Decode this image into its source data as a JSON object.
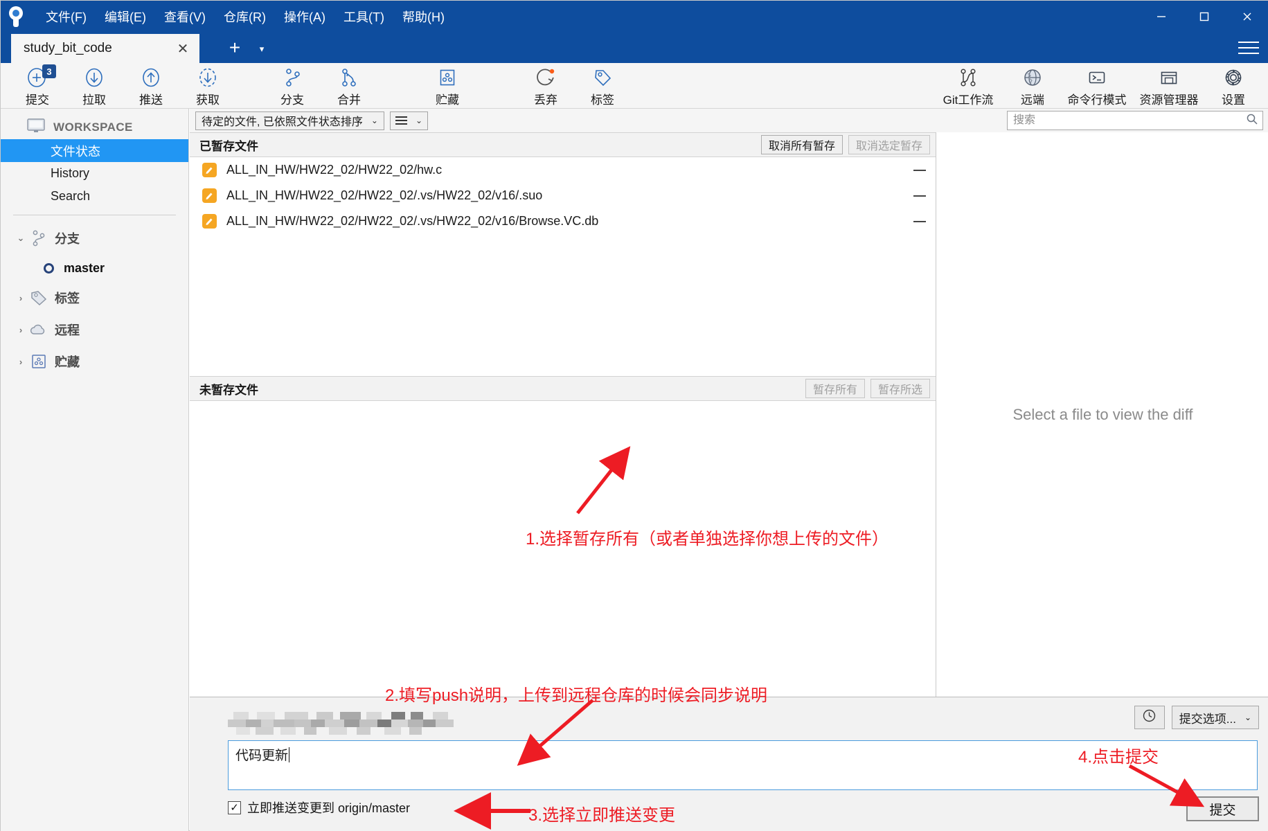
{
  "window": {
    "menu": [
      "文件(F)",
      "编辑(E)",
      "查看(V)",
      "仓库(R)",
      "操作(A)",
      "工具(T)",
      "帮助(H)"
    ],
    "minimize_label": "最小化",
    "maximize_label": "最大化",
    "close_label": "关闭"
  },
  "tabs": {
    "active_title": "study_bit_code",
    "close_label": "✕",
    "add_label": "+",
    "dropdown_label": "▾"
  },
  "toolbar": {
    "left": [
      {
        "label": "提交",
        "icon": "commit-plus-icon",
        "badge": "3"
      },
      {
        "label": "拉取",
        "icon": "pull-down-arrow-icon",
        "badge": ""
      },
      {
        "label": "推送",
        "icon": "push-up-arrow-icon",
        "badge": ""
      },
      {
        "label": "获取",
        "icon": "fetch-dashed-arrow-icon",
        "badge": ""
      },
      {
        "label": "分支",
        "icon": "branch-icon",
        "badge": ""
      },
      {
        "label": "合并",
        "icon": "merge-icon",
        "badge": ""
      },
      {
        "label": "贮藏",
        "icon": "stash-icon",
        "badge": ""
      },
      {
        "label": "丢弃",
        "icon": "discard-revert-icon",
        "badge": ""
      },
      {
        "label": "标签",
        "icon": "tag-icon",
        "badge": ""
      }
    ],
    "right": [
      {
        "label": "Git工作流",
        "icon": "git-flow-icon"
      },
      {
        "label": "远端",
        "icon": "globe-remote-icon"
      },
      {
        "label": "命令行模式",
        "icon": "terminal-icon"
      },
      {
        "label": "资源管理器",
        "icon": "explorer-folder-icon"
      },
      {
        "label": "设置",
        "icon": "gear-icon"
      }
    ]
  },
  "sidebar": {
    "workspace_label": "WORKSPACE",
    "nav": [
      {
        "label": "文件状态",
        "active": true
      },
      {
        "label": "History",
        "active": false
      },
      {
        "label": "Search",
        "active": false
      }
    ],
    "sections": [
      {
        "label": "分支",
        "icon": "branch-icon",
        "expanded": true,
        "chevron": "⌄"
      },
      {
        "label": "标签",
        "icon": "tag-icon",
        "expanded": false,
        "chevron": "›"
      },
      {
        "label": "远程",
        "icon": "cloud-icon",
        "expanded": false,
        "chevron": "›"
      },
      {
        "label": "贮藏",
        "icon": "stash-icon",
        "expanded": false,
        "chevron": "›"
      }
    ],
    "branches": [
      "master"
    ]
  },
  "filter_bar": {
    "sort_value": "待定的文件, 已依照文件状态排序",
    "sort_caret": "⌄",
    "view_caret": "⌄",
    "search_placeholder": "搜索",
    "search_value": ""
  },
  "staged": {
    "title": "已暂存文件",
    "unstage_all_label": "取消所有暂存",
    "unstage_selected_label": "取消选定暂存",
    "files": [
      "ALL_IN_HW/HW22_02/HW22_02/hw.c",
      "ALL_IN_HW/HW22_02/HW22_02/.vs/HW22_02/v16/.suo",
      "ALL_IN_HW/HW22_02/HW22_02/.vs/HW22_02/v16/Browse.VC.db"
    ]
  },
  "unstaged": {
    "title": "未暂存文件",
    "stage_all_label": "暂存所有",
    "stage_selected_label": "暂存所选",
    "files": []
  },
  "diff": {
    "empty_message": "Select a file to view the diff"
  },
  "commit": {
    "author_redacted": true,
    "message_value": "代码更新",
    "message_placeholder": "",
    "history_button_label": "提交历史",
    "options_button_label": "提交选项...",
    "options_caret": "⌄",
    "push_checkbox_label": "立即推送变更到 origin/master",
    "push_checkbox_checked": true,
    "checkmark": "✓",
    "commit_button_label": "提交"
  },
  "annotations": [
    {
      "id": 1,
      "text": "1.选择暂存所有（或者单独选择你想上传的文件）"
    },
    {
      "id": 2,
      "text": "2.填写push说明，上传到远程仓库的时候会同步说明"
    },
    {
      "id": 3,
      "text": "3.选择立即推送变更"
    },
    {
      "id": 4,
      "text": "4.点击提交"
    }
  ],
  "colors": {
    "titlebar": "#0e4d9e",
    "accent_blue": "#2196f3",
    "annotation_red": "#ed1c24",
    "modified_file": "#f5a623",
    "icon_blue": "#2f6fbd"
  }
}
